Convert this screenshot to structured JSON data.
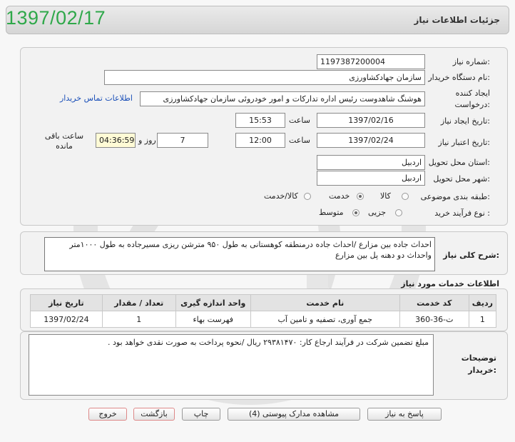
{
  "header": {
    "date_stamp": "1397/02/17",
    "title": "جزئیات اطلاعات نیاز"
  },
  "form": {
    "need_number_label": "شماره نیاز:",
    "need_number": "1197387200004",
    "buyer_org_label": "نام دستگاه خریدار:",
    "buyer_org": "سازمان جهادکشاورزی",
    "creator_label_1": "ایجاد کننده",
    "creator_label_2": "درخواست:",
    "creator": "هوشنگ شاهدوست رئیس اداره تدارکات و امور خودروئی سازمان جهادکشاورزی",
    "contact_link": "اطلاعات تماس خریدار",
    "created_date_label": "تاریخ ایجاد نیاز:",
    "created_date": "1397/02/16",
    "time_label": "ساعت",
    "created_time": "15:53",
    "validity_date_label": "تاریخ اعتبار نیاز:",
    "validity_date": "1397/02/24",
    "validity_time": "12:00",
    "days": "7",
    "days_label": "روز و",
    "remaining_time": "04:36:59",
    "remaining_label_1": "ساعت باقی",
    "remaining_label_2": "مانده",
    "province_label": "استان محل تحویل:",
    "province": "اردبیل",
    "city_label": "شهر محل تحویل:",
    "city": "اردبیل",
    "category_label": "طبقه بندی موضوعی:",
    "category_options": [
      "کالا",
      "خدمت",
      "کالا/خدمت"
    ],
    "category_selected": "خدمت",
    "process_label": "نوع فرآیند خرید :",
    "process_options": [
      "جزیی",
      "متوسط"
    ],
    "process_selected": "متوسط"
  },
  "description": {
    "label": "شرح کلی نیاز:",
    "text": "احداث جاده بین مزارع /احداث جاده درمنطقه کوهستانی به طول ۹۵۰ مترشن ریزی مسیرجاده به طول ۱۰۰۰متر واحداث دو دهنه پل بین مزارع"
  },
  "services": {
    "title": "اطلاعات خدمات مورد نیاز",
    "columns": [
      "ردیف",
      "کد خدمت",
      "نام خدمت",
      "واحد اندازه گیری",
      "تعداد / مقدار",
      "تاریخ نیاز"
    ],
    "rows": [
      {
        "row": "1",
        "code": "ت-36-360",
        "name": "جمع آوری، تصفیه و تامین آب",
        "unit": "فهرست بهاء",
        "qty": "1",
        "date": "1397/02/24"
      }
    ]
  },
  "buyer_notes": {
    "label_1": "توضیحات",
    "label_2": "خریدار:",
    "text": "مبلغ تضمین شرکت در فرآیند ارجاع کار: ۲۹۳۸۱۴۷۰ ریال   /نحوه پرداخت به صورت نقدی خواهد بود ."
  },
  "buttons": {
    "reply": "پاسخ به نیاز",
    "attachments": "مشاهده مدارک پیوستی (4)",
    "print": "چاپ",
    "back": "بازگشت",
    "exit": "خروج"
  }
}
